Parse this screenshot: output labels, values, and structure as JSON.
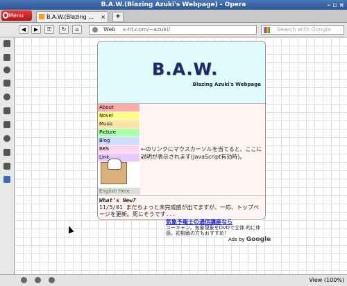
{
  "window": {
    "title": "B.A.W.(Blazing Azuki's Webpage) - Opera",
    "controls": "– ▫ ×"
  },
  "tabs": {
    "opera_menu": "Menu",
    "active_tab": "B.A.W.(Blazing ...",
    "close": "×",
    "new_tab": "+"
  },
  "address": {
    "web_label": "Web",
    "url": "s-ht.com/~azuki/",
    "search_placeholder": "Search with Google"
  },
  "page": {
    "title": "B.A.W.",
    "subtitle": "Blazing Azuki's Webpage",
    "menu": [
      {
        "label": "About",
        "color": "#ffaaaa"
      },
      {
        "label": "Novel",
        "color": "#ffff88"
      },
      {
        "label": "Music",
        "color": "#ffe4a8"
      },
      {
        "label": "Picture",
        "color": "#aaffaa"
      },
      {
        "label": "Blog",
        "color": "#ccddff"
      },
      {
        "label": "BBS",
        "color": "#ffd6f0"
      },
      {
        "label": "Link",
        "color": "#e8c8ff"
      }
    ],
    "english": "English Here",
    "description": "←のリンクにマウスカーソルを当てると、ここに説明が表示されます(JavaScript有効時)。",
    "news_heading": "What's New?",
    "news_text": "11/5/01 まだちょっと未完成感が出てますが、一応、トップページを更新。死にそうです..."
  },
  "ad": {
    "link": "気象予報士の通信講座なら",
    "text": "ユーキャン。気象現象をDVDで立体 的に体感。初挑戦の方もおすすめ！",
    "ads_by": "Ads by",
    "google": "Google"
  },
  "status": {
    "zoom": "View (100%)"
  }
}
